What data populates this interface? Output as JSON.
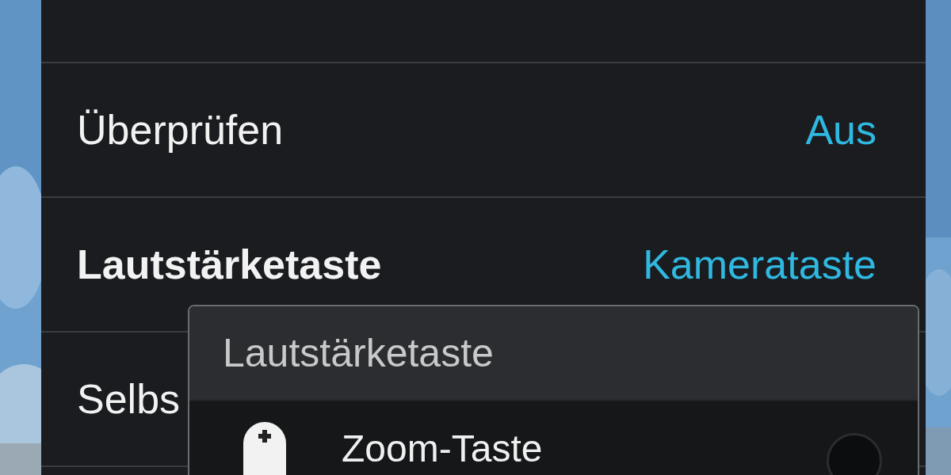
{
  "settings": [
    {
      "label": "Überprüfen",
      "value": "Aus",
      "selected": false
    },
    {
      "label": "Lautstärketaste",
      "value": "Kamerataste",
      "selected": true
    },
    {
      "label": "Selbs",
      "selected": false
    }
  ],
  "dialog": {
    "title": "Lautstärketaste",
    "options": [
      {
        "label": "Zoom-Taste",
        "selected": false
      }
    ]
  }
}
